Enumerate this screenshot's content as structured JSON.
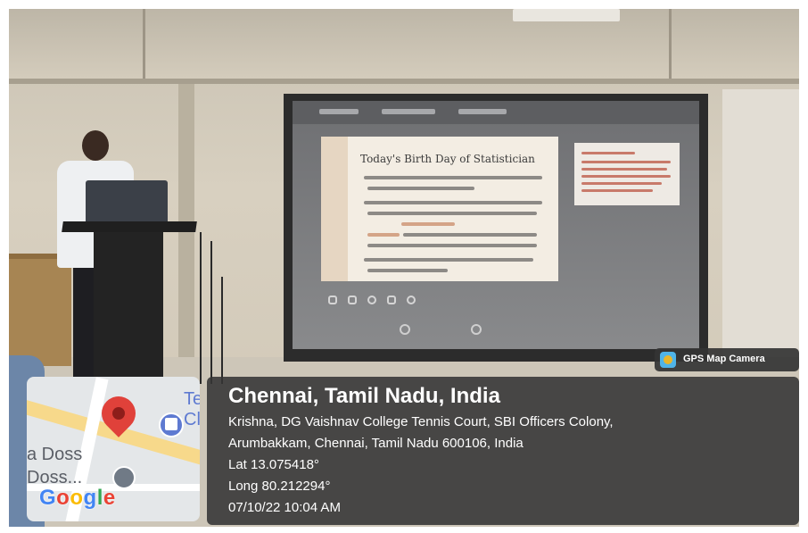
{
  "photo": {
    "slide_title": "Today's Birth Day of Statistician"
  },
  "map": {
    "label_top": "Te\nCl",
    "label_doss_1": "a Doss",
    "label_doss_2": "Doss...",
    "google_letters": [
      "G",
      "o",
      "o",
      "g",
      "l",
      "e"
    ],
    "google_colors": [
      "#4285F4",
      "#EA4335",
      "#FBBC05",
      "#4285F4",
      "#34A853",
      "#EA4335"
    ]
  },
  "badge": {
    "text": "GPS Map Camera"
  },
  "info": {
    "title": "Chennai, Tamil Nadu, India",
    "address_line1": "Krishna, DG Vaishnav College Tennis Court, SBI Officers Colony,",
    "address_line2": "Arumbakkam, Chennai, Tamil Nadu 600106, India",
    "lat": "Lat 13.075418°",
    "long": "Long 80.212294°",
    "datetime": "07/10/22 10:04 AM"
  }
}
